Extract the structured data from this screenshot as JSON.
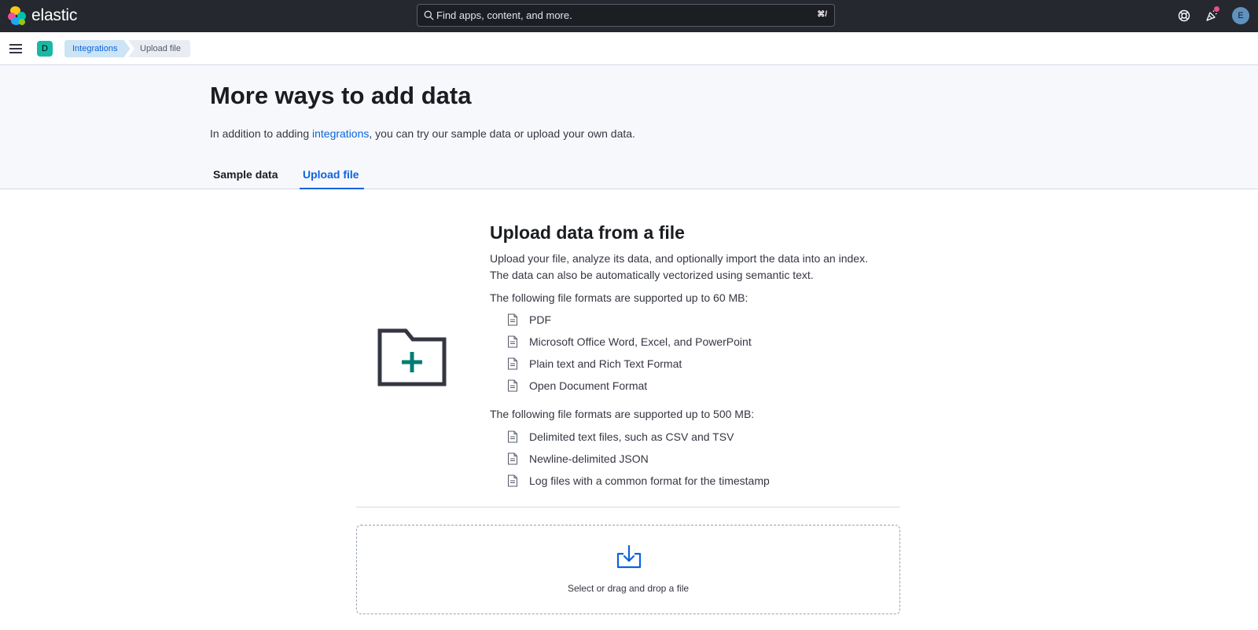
{
  "header": {
    "logo_text": "elastic",
    "search_placeholder": "Find apps, content, and more.",
    "search_shortcut": "⌘/",
    "avatar_initial": "E"
  },
  "nav": {
    "space_initial": "D",
    "breadcrumbs": [
      "Integrations",
      "Upload file"
    ]
  },
  "page": {
    "title": "More ways to add data",
    "desc_prefix": "In addition to adding ",
    "desc_link": "integrations",
    "desc_suffix": ", you can try our sample data or upload your own data.",
    "tabs": [
      "Sample data",
      "Upload file"
    ],
    "active_tab": "Upload file"
  },
  "upload": {
    "title": "Upload data from a file",
    "intro_line1": "Upload your file, analyze its data, and optionally import the data into an index.",
    "intro_line2": "The data can also be automatically vectorized using semantic text.",
    "group1_heading": "The following file formats are supported up to 60 MB:",
    "group1_items": [
      "PDF",
      "Microsoft Office Word, Excel, and PowerPoint",
      "Plain text and Rich Text Format",
      "Open Document Format"
    ],
    "group2_heading": "The following file formats are supported up to 500 MB:",
    "group2_items": [
      "Delimited text files, such as CSV and TSV",
      "Newline-delimited JSON",
      "Log files with a common format for the timestamp"
    ],
    "dropzone_label": "Select or drag and drop a file"
  },
  "colors": {
    "header_bg": "#25282f",
    "accent": "#0b64dd",
    "space_badge": "#18b9a4",
    "folder_plus": "#017d73",
    "notification": "#e6508c"
  }
}
